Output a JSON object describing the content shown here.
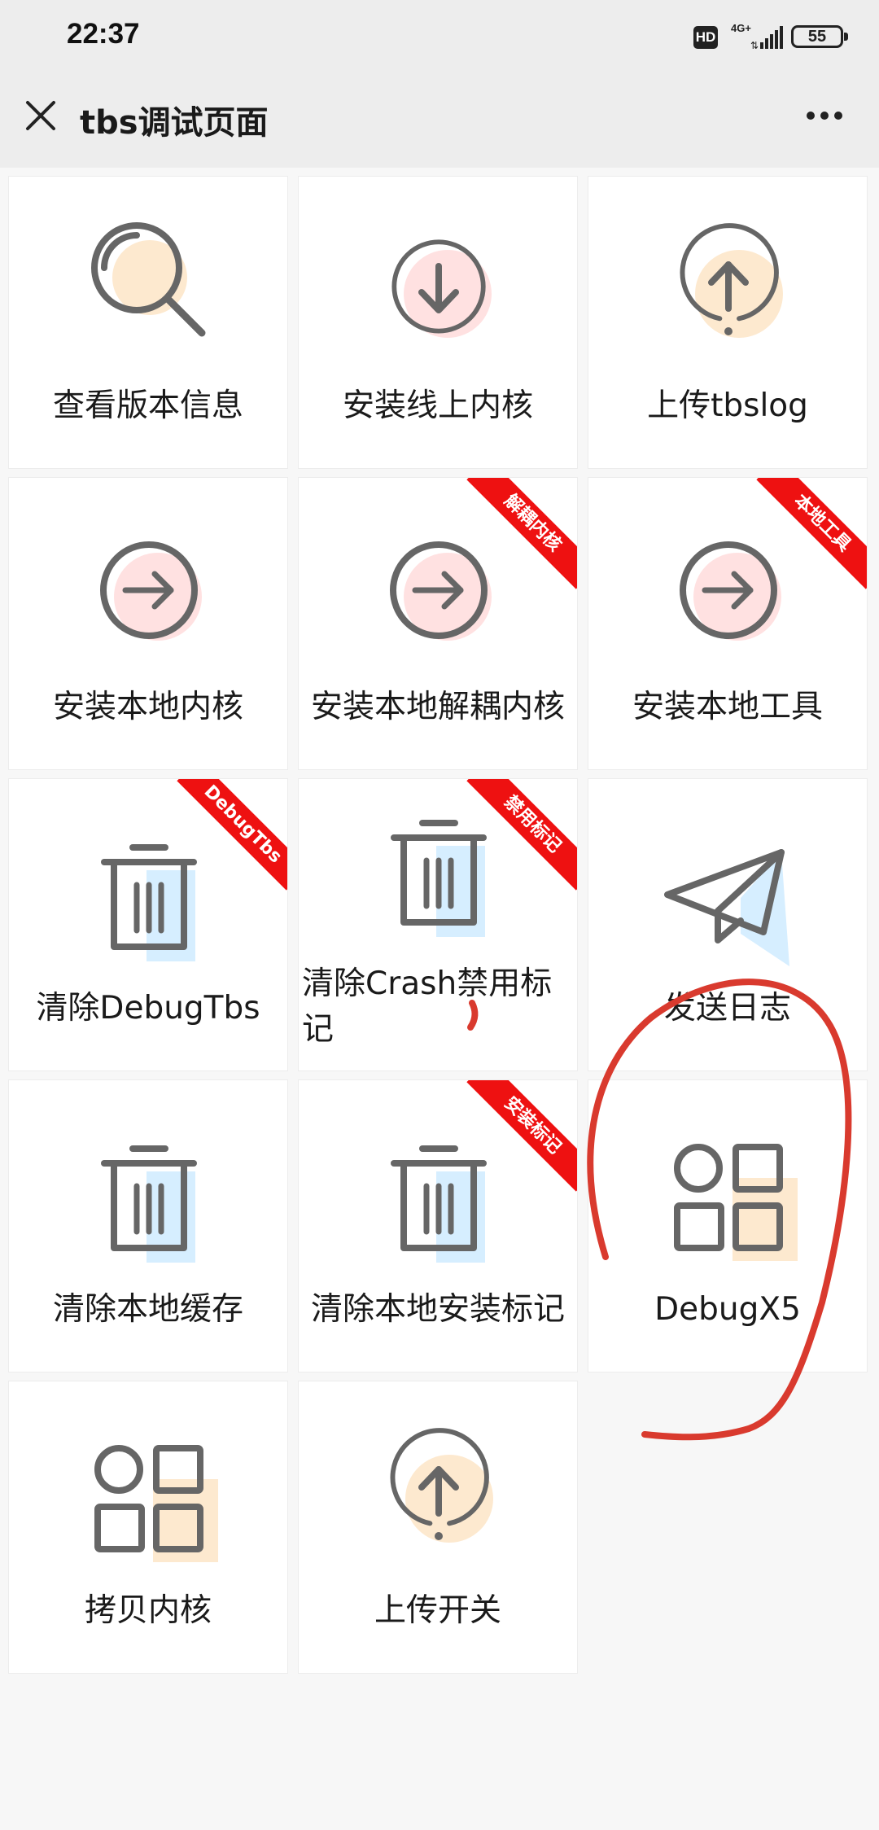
{
  "status_bar": {
    "time": "22:37",
    "hd": "HD",
    "network": "4G+",
    "battery": "55"
  },
  "nav": {
    "title": "tbs调试页面"
  },
  "tiles": [
    {
      "label": "查看版本信息",
      "icon": "search-icon",
      "ribbon": ""
    },
    {
      "label": "安装线上内核",
      "icon": "download-icon",
      "ribbon": ""
    },
    {
      "label": "上传tbslog",
      "icon": "upload-icon",
      "ribbon": ""
    },
    {
      "label": "安装本地内核",
      "icon": "arrow-right-icon",
      "ribbon": ""
    },
    {
      "label": "安装本地解耦内核",
      "icon": "arrow-right-icon",
      "ribbon": "解耦内核"
    },
    {
      "label": "安装本地工具",
      "icon": "arrow-right-icon",
      "ribbon": "本地工具"
    },
    {
      "label": "清除DebugTbs",
      "icon": "trash-icon",
      "ribbon": "DebugTbs"
    },
    {
      "label": "清除Crash禁用标记",
      "icon": "trash-icon",
      "ribbon": "禁用标记"
    },
    {
      "label": "发送日志",
      "icon": "paper-plane-icon",
      "ribbon": ""
    },
    {
      "label": "清除本地缓存",
      "icon": "trash-icon",
      "ribbon": ""
    },
    {
      "label": "清除本地安装标记",
      "icon": "trash-icon",
      "ribbon": "安装标记"
    },
    {
      "label": "DebugX5",
      "icon": "apps-grid-icon",
      "ribbon": ""
    },
    {
      "label": "拷贝内核",
      "icon": "apps-grid-icon",
      "ribbon": ""
    },
    {
      "label": "上传开关",
      "icon": "upload-icon",
      "ribbon": ""
    }
  ],
  "colors": {
    "accent_orange": "#fde9cf",
    "accent_pink": "#ffe1e1",
    "accent_blue": "#d6eeff",
    "icon_stroke": "#666666",
    "ribbon": "#ee1111",
    "annotation": "#d93a2e"
  }
}
